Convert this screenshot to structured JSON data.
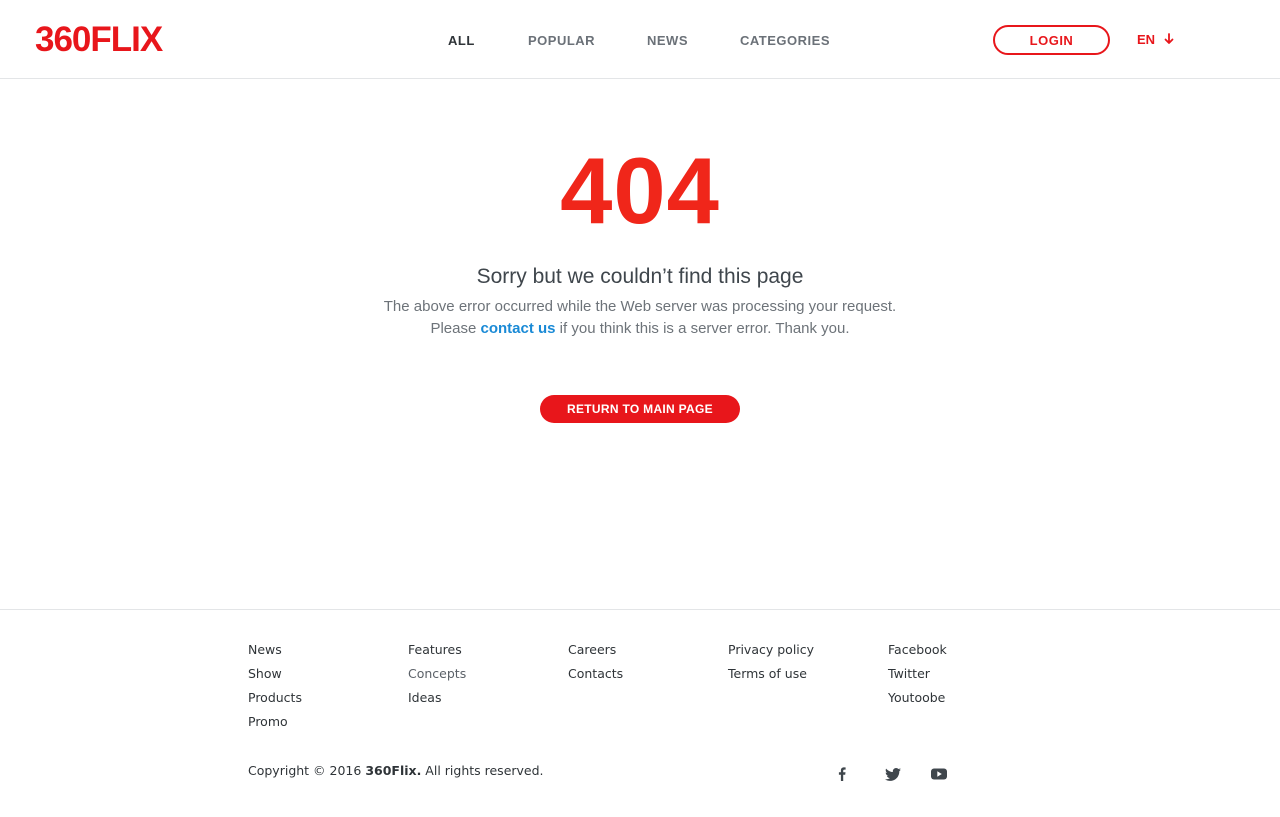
{
  "header": {
    "logo": "360FLIX",
    "nav": [
      {
        "label": "ALL",
        "active": true
      },
      {
        "label": "POPULAR",
        "active": false
      },
      {
        "label": "NEWS",
        "active": false
      },
      {
        "label": "CATEGORIES",
        "active": false
      }
    ],
    "login_label": "LOGIN",
    "language": "EN"
  },
  "error": {
    "code": "404",
    "title": "Sorry but we couldn’t find this page",
    "line1": "The above error occurred while the Web server was processing your request.",
    "line2_prefix": "Please ",
    "contact_link": "contact us",
    "line2_suffix": " if you think this is a server error. Thank you.",
    "return_label": "RETURN TO MAIN PAGE"
  },
  "footer": {
    "columns": [
      [
        "News",
        "Show",
        "Products",
        "Promo"
      ],
      [
        "Features",
        "Concepts",
        "Ideas"
      ],
      [
        "Careers",
        "Contacts"
      ],
      [
        "Privacy policy",
        "Terms of use"
      ],
      [
        "Facebook",
        "Twitter",
        "Youtoobe"
      ]
    ],
    "copyright_prefix": "Copyright © 2016 ",
    "copyright_brand": "360Flix.",
    "copyright_suffix": " All rights reserved.",
    "social_icons": [
      "facebook-icon",
      "twitter-icon",
      "youtube-icon"
    ]
  },
  "colors": {
    "brand_red": "#e8161b",
    "error_red": "#f0261a",
    "link_blue": "#1a8ad6",
    "text_dark": "#3f464c"
  }
}
